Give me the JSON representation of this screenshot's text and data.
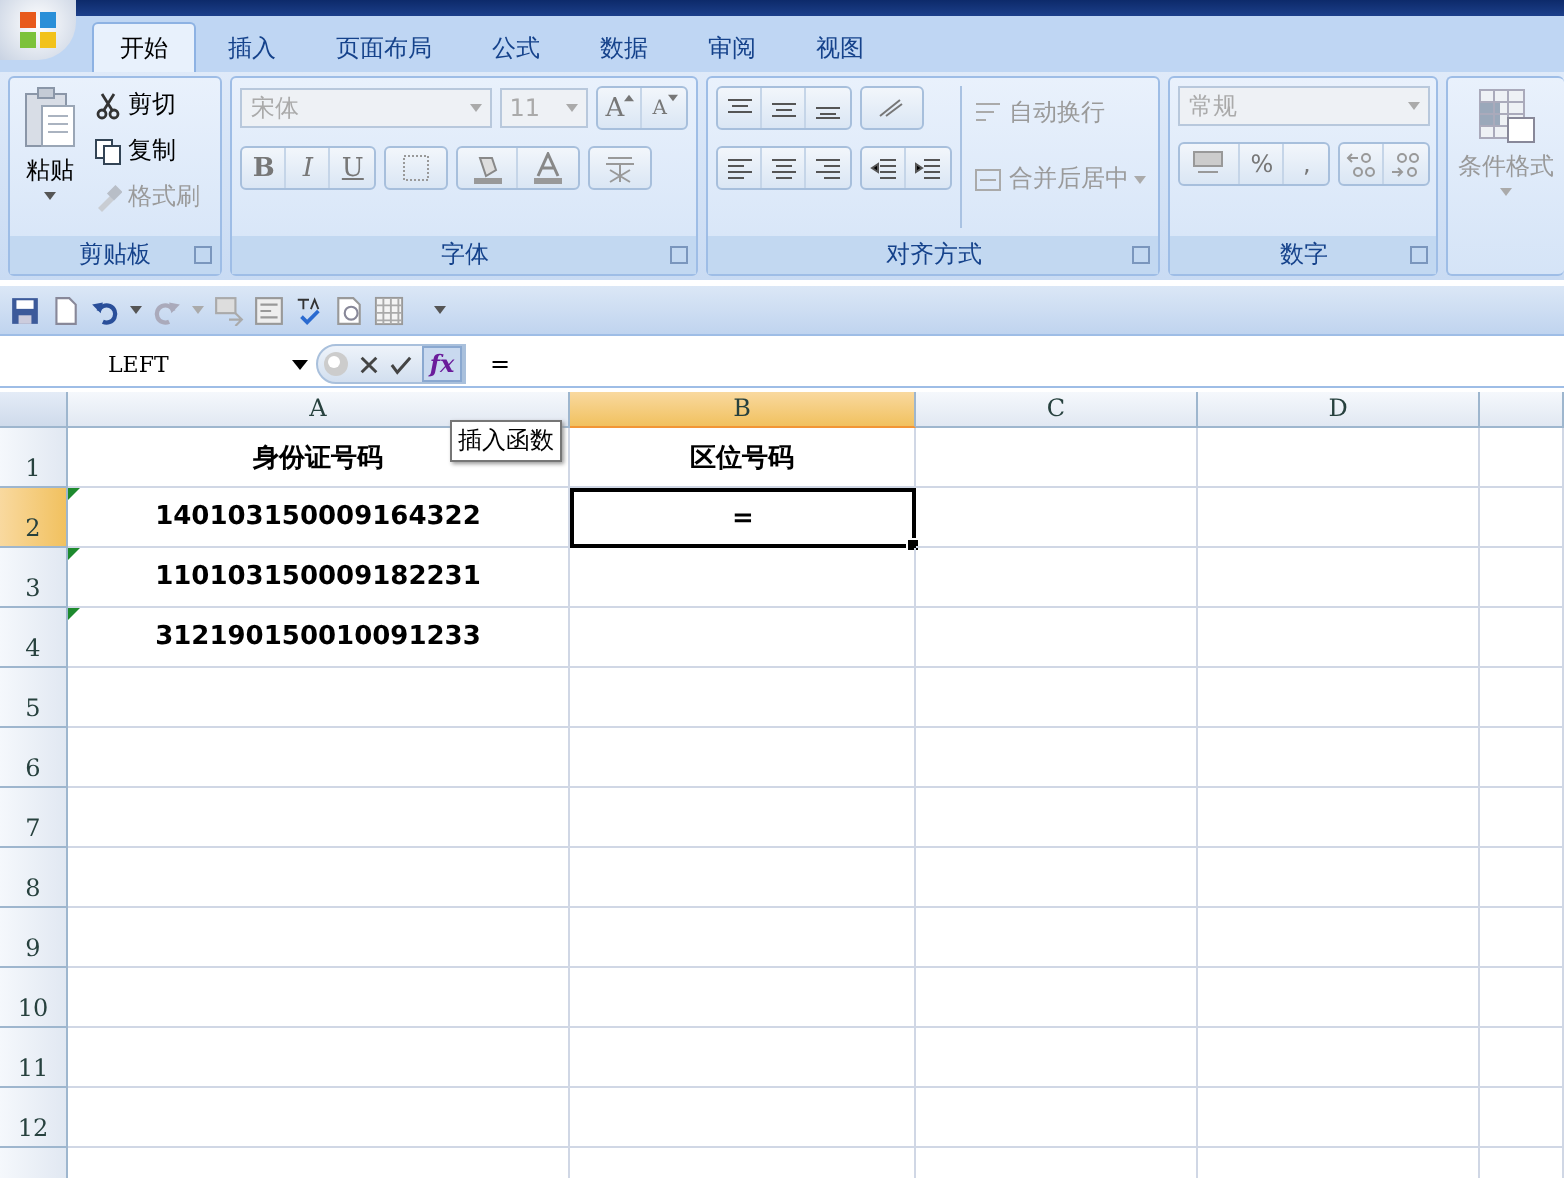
{
  "tabs": [
    {
      "label": "开始",
      "selected": true
    },
    {
      "label": "插入",
      "selected": false
    },
    {
      "label": "页面布局",
      "selected": false
    },
    {
      "label": "公式",
      "selected": false
    },
    {
      "label": "数据",
      "selected": false
    },
    {
      "label": "审阅",
      "selected": false
    },
    {
      "label": "视图",
      "selected": false
    }
  ],
  "clipboard": {
    "paste": "粘贴",
    "items": [
      {
        "kind": "cut",
        "label": "剪切",
        "disabled": false
      },
      {
        "kind": "copy",
        "label": "复制",
        "disabled": false
      },
      {
        "kind": "painter",
        "label": "格式刷",
        "disabled": true
      }
    ],
    "label": "剪贴板"
  },
  "font": {
    "name": "宋体",
    "size": "11",
    "grow": "A",
    "shrink": "A",
    "bold": "B",
    "italic": "I",
    "underline": "U",
    "label": "字体"
  },
  "alignment": {
    "wrap": "自动换行",
    "merge": "合并后居中",
    "label": "对齐方式"
  },
  "number": {
    "format": "常规",
    "percent": "%",
    "comma": ",",
    "label": "数字"
  },
  "styles": {
    "conditional": "条件格式"
  },
  "name_box": "LEFT",
  "function_button": "fx",
  "formula": "=",
  "tooltip": "插入函数",
  "columns": [
    {
      "label": "A",
      "selected": false
    },
    {
      "label": "B",
      "selected": true
    },
    {
      "label": "C",
      "selected": false
    },
    {
      "label": "D",
      "selected": false
    }
  ],
  "rows": [
    {
      "label": "1",
      "selected": false,
      "cells": [
        {
          "text": "身份证号码",
          "flagged": false,
          "active": false
        },
        {
          "text": "区位号码",
          "flagged": false,
          "active": false
        }
      ]
    },
    {
      "label": "2",
      "selected": true,
      "cells": [
        {
          "text": "140103150009164322",
          "flagged": true,
          "active": false
        },
        {
          "text": "=",
          "flagged": false,
          "active": true
        }
      ]
    },
    {
      "label": "3",
      "selected": false,
      "cells": [
        {
          "text": "110103150009182231",
          "flagged": true,
          "active": false
        }
      ]
    },
    {
      "label": "4",
      "selected": false,
      "cells": [
        {
          "text": "312190150010091233",
          "flagged": true,
          "active": false
        }
      ]
    },
    {
      "label": "5",
      "selected": false
    },
    {
      "label": "6",
      "selected": false
    },
    {
      "label": "7",
      "selected": false
    },
    {
      "label": "8",
      "selected": false
    },
    {
      "label": "9",
      "selected": false
    },
    {
      "label": "10",
      "selected": false
    },
    {
      "label": "11",
      "selected": false
    },
    {
      "label": "12",
      "selected": false
    }
  ]
}
